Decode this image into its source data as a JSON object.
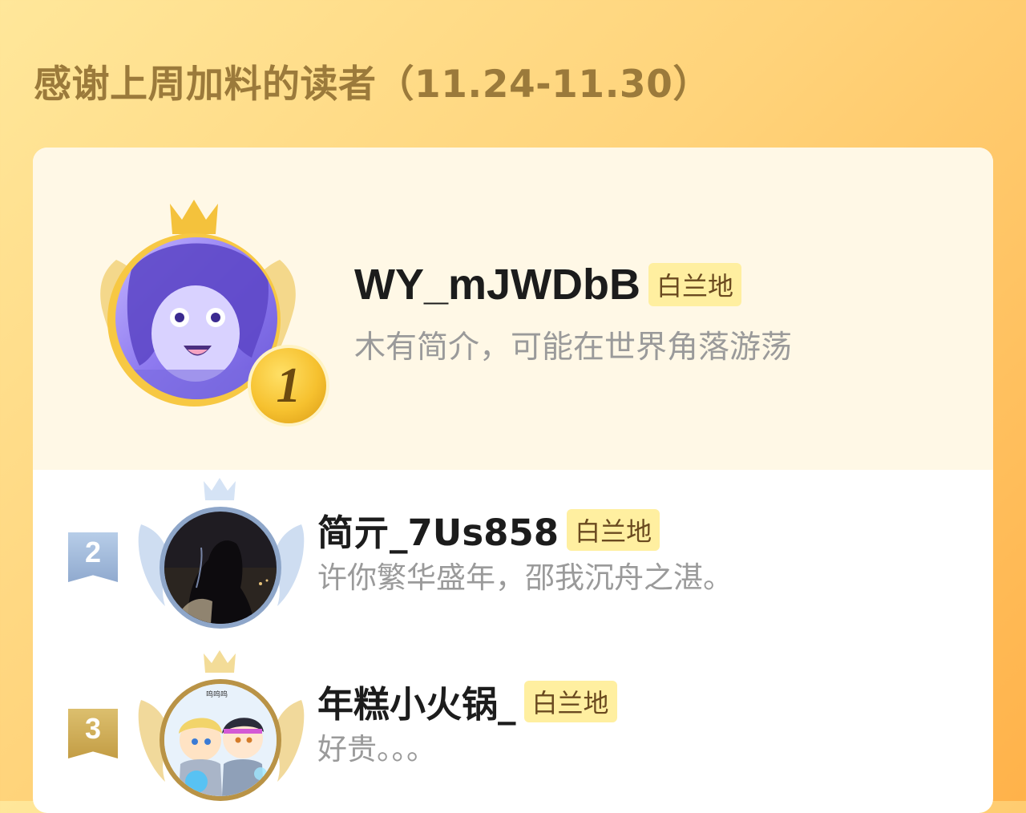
{
  "header": {
    "title": "感谢上周加料的读者（11.24-11.30）"
  },
  "readers": [
    {
      "rank": "1",
      "username": "WY_mJWDbB",
      "tag": "白兰地",
      "bio": "木有简介，可能在世界角落游荡",
      "avatar_icon": "anime-girl-avatar-purple",
      "badge_icon": "gold-medal-icon"
    },
    {
      "rank": "2",
      "username": "简亓_7Us858",
      "tag": "白兰地",
      "bio": "许你繁华盛年，邵我沉舟之湛。",
      "avatar_icon": "dark-photo-avatar",
      "badge_icon": "silver-ribbon-icon"
    },
    {
      "rank": "3",
      "username": "年糕小火锅_",
      "tag": "白兰地",
      "bio": "好贵。。。",
      "avatar_icon": "chibi-couple-avatar",
      "badge_icon": "bronze-ribbon-icon",
      "avatar_caption": "呜呜呜"
    }
  ],
  "colors": {
    "gold": "#f2c23a",
    "silver": "#9fb7d6",
    "bronze": "#c8a24e",
    "tag_bg": "#ffefa0"
  }
}
